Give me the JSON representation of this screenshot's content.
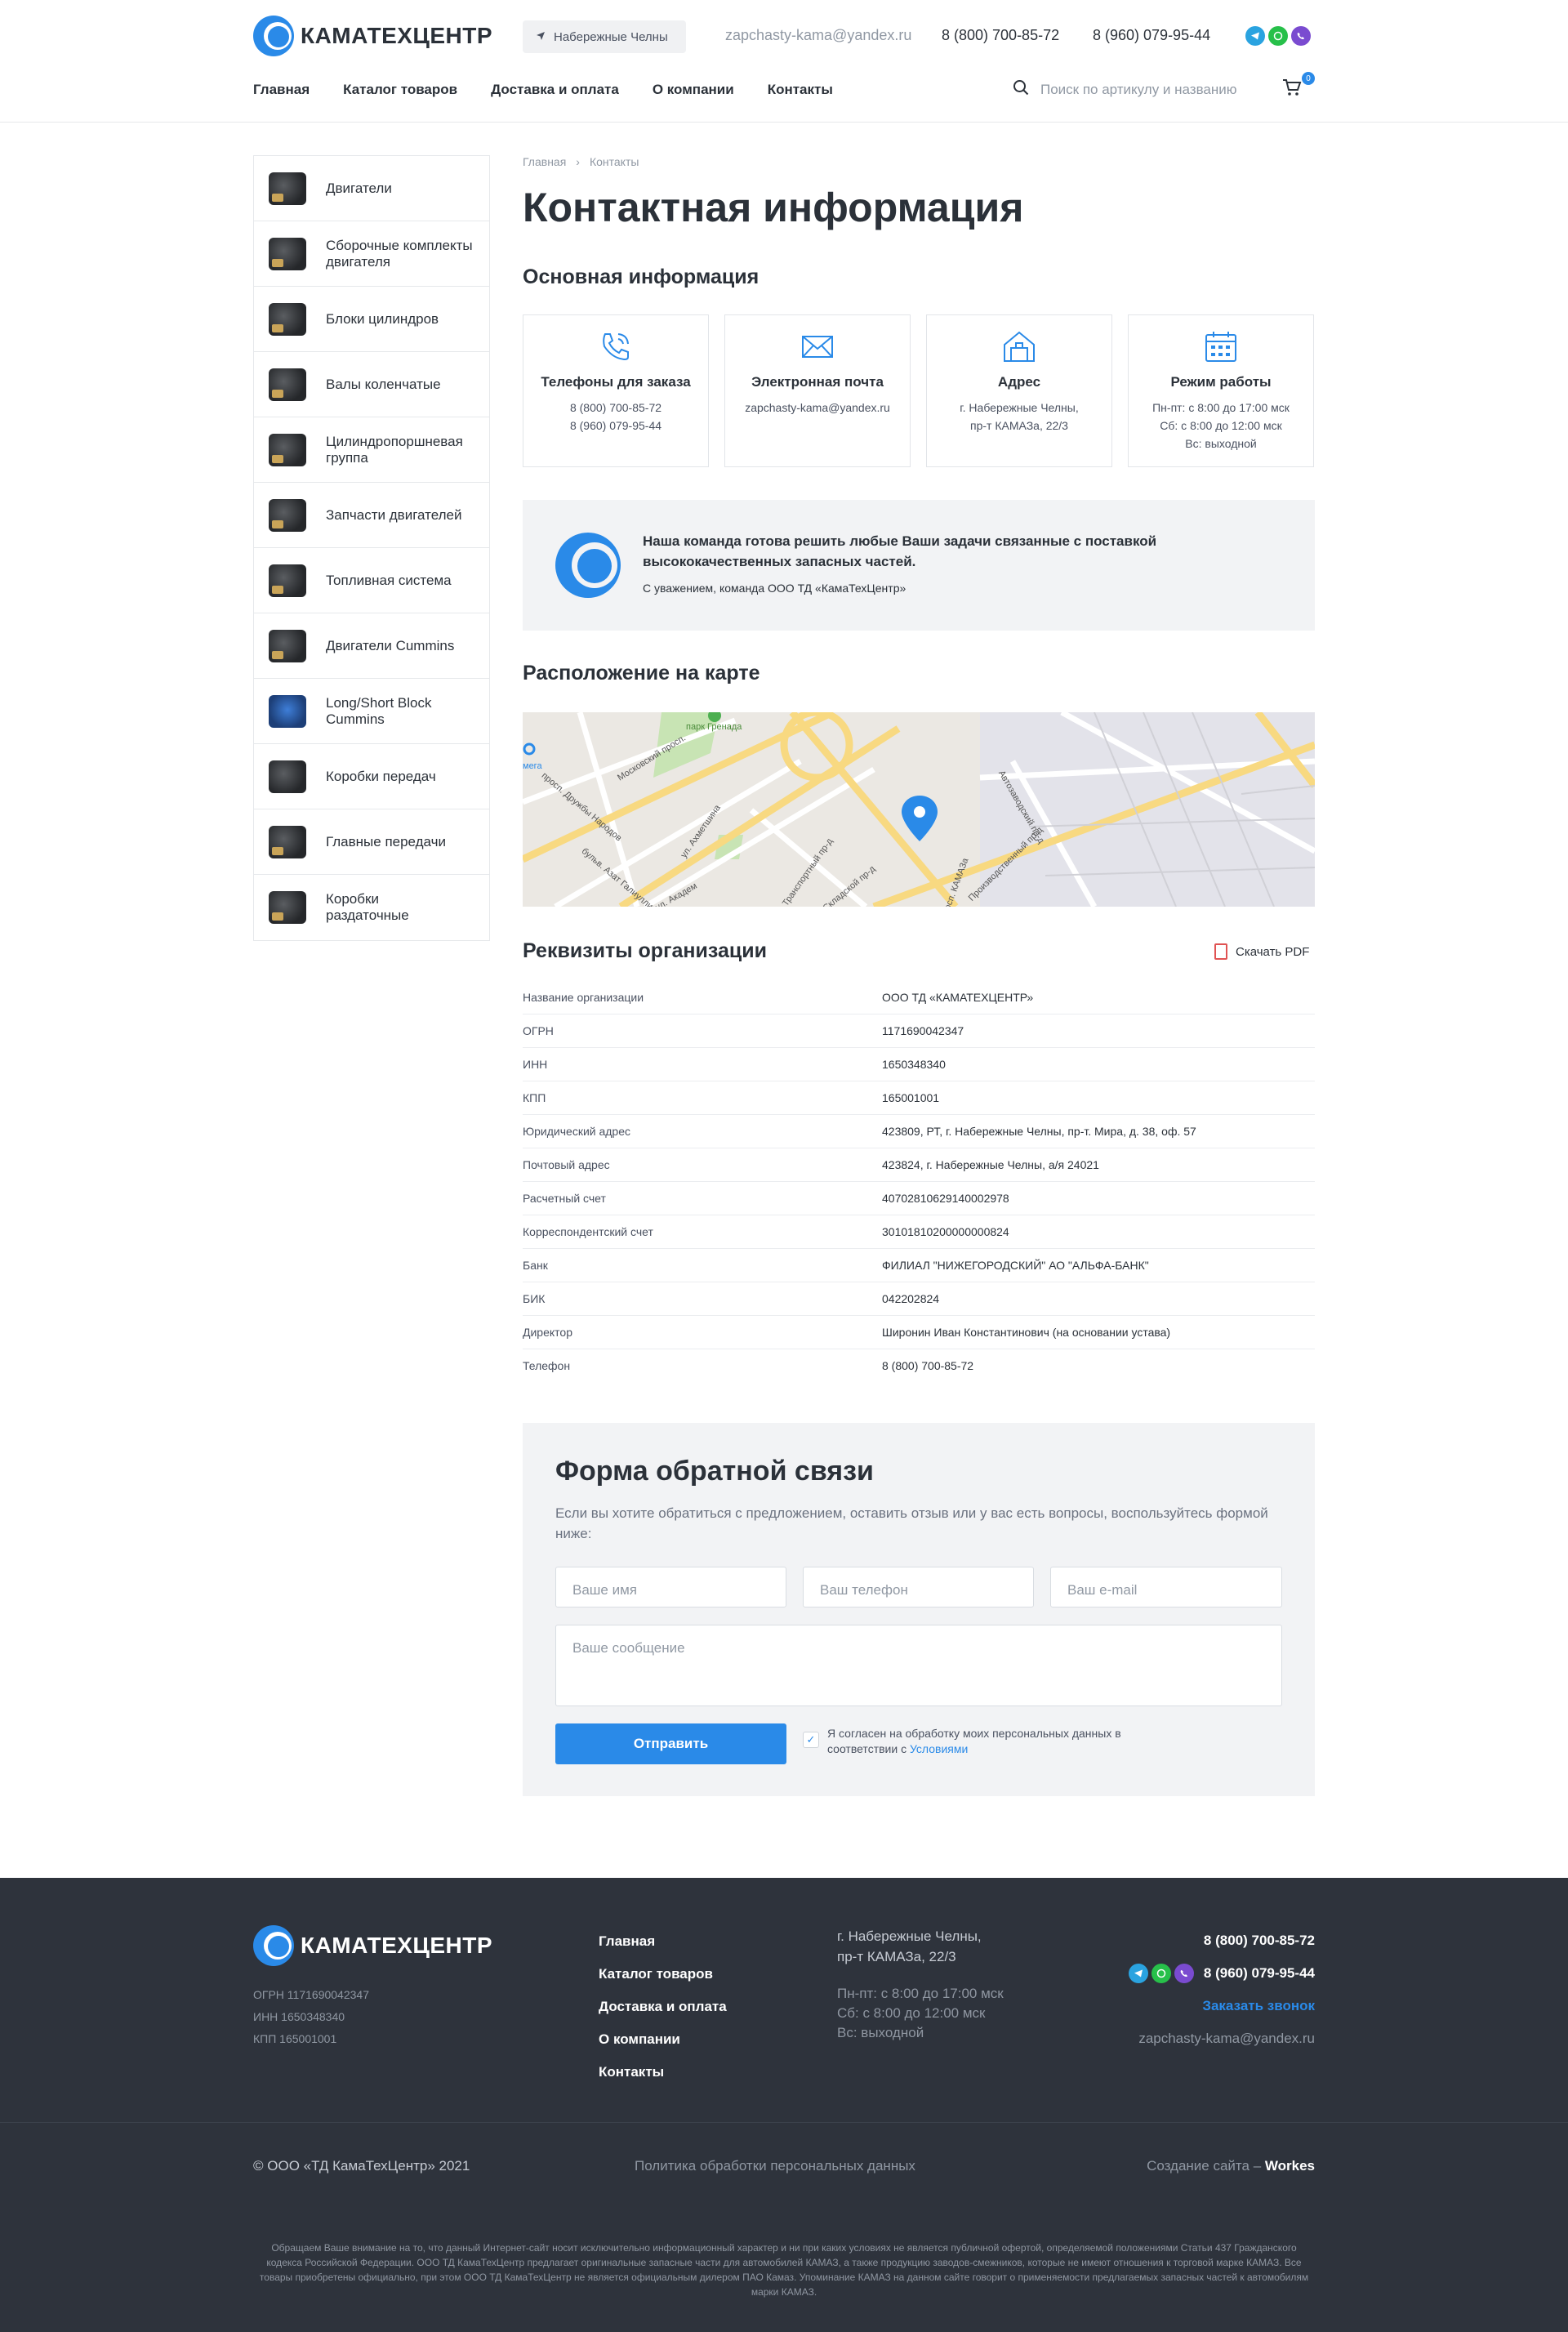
{
  "header": {
    "logo_text": "КАМАТЕХЦЕНТР",
    "city": "Набережные Челны",
    "email": "zapchasty-kama@yandex.ru",
    "phone1": "8 (800) 700-85-72",
    "phone2": "8 (960) 079-95-44",
    "social": [
      {
        "name": "telegram-icon",
        "color": "#2aa3e0"
      },
      {
        "name": "whatsapp-icon",
        "color": "#27c04a"
      },
      {
        "name": "viber-icon",
        "color": "#7a4bd0"
      }
    ],
    "nav": [
      "Главная",
      "Каталог товаров",
      "Доставка и оплата",
      "О компании",
      "Контакты"
    ],
    "search_placeholder": "Поиск по артикулу и названию",
    "cart_count": "0"
  },
  "sidebar": {
    "items": [
      "Двигатели",
      "Сборочные комплекты двигателя",
      "Блоки цилиндров",
      "Валы коленчатые",
      "Цилиндропоршневая группа",
      "Запчасти двигателей",
      "Топливная система",
      "Двигатели Cummins",
      "Long/Short Block Cummins",
      "Коробки передач",
      "Главные передачи",
      "Коробки раздаточные"
    ]
  },
  "main": {
    "breadcrumbs": [
      "Главная",
      "Контакты"
    ],
    "title": "Контактная информация",
    "basic_title": "Основная информация",
    "cards": [
      {
        "title": "Телефоны для заказа",
        "lines": [
          "8 (800) 700-85-72",
          "8 (960) 079-95-44"
        ]
      },
      {
        "title": "Электронная почта",
        "lines": [
          "zapchasty-kama@yandex.ru"
        ]
      },
      {
        "title": "Адрес",
        "lines": [
          "г. Набережные Челны,",
          "пр-т КАМАЗа, 22/3"
        ]
      },
      {
        "title": "Режим работы",
        "lines": [
          "Пн-пт: с 8:00 до 17:00 мск",
          "Сб: с 8:00 до 12:00 мск",
          "Вс: выходной"
        ]
      }
    ],
    "team_text": "Наша команда готова решить любые Ваши задачи связанные с поставкой высококачественных запасных частей.",
    "team_sign": "С уважением, команда ООО ТД «КамаТехЦентр»",
    "map_title": "Расположение на карте",
    "map_labels": [
      "парк Гренада",
      "Московский просп.",
      "просп. Дружбы Народов",
      "ул. Ахметшина",
      "бульв. Азат Галиуллин",
      "Транспортный пр-д",
      "Автозаводский пр-д",
      "Производственный пр-д",
      "Складской пр-д",
      "просп. КАМАЗа",
      "ул. Академ",
      "мега"
    ],
    "req_title": "Реквизиты организации",
    "pdf_label": "Скачать PDF",
    "requisites": [
      {
        "k": "Название организации",
        "v": "ООО ТД «КАМАТЕХЦЕНТР»"
      },
      {
        "k": "ОГРН",
        "v": "1171690042347"
      },
      {
        "k": "ИНН",
        "v": "1650348340"
      },
      {
        "k": "КПП",
        "v": "165001001"
      },
      {
        "k": "Юридический адрес",
        "v": "423809, РТ, г. Набережные Челны, пр-т. Мира, д. 38, оф. 57"
      },
      {
        "k": "Почтовый адрес",
        "v": "423824, г. Набережные Челны, а/я 24021"
      },
      {
        "k": "Расчетный счет",
        "v": "40702810629140002978"
      },
      {
        "k": "Корреспондентский счет",
        "v": "30101810200000000824"
      },
      {
        "k": "Банк",
        "v": "ФИЛИАЛ \"НИЖЕГОРОДСКИЙ\" АО \"АЛЬФА-БАНК\""
      },
      {
        "k": "БИК",
        "v": "042202824"
      },
      {
        "k": "Директор",
        "v": "Широнин Иван Константинович (на основании устава)"
      },
      {
        "k": "Телефон",
        "v": "8 (800) 700-85-72"
      }
    ],
    "form": {
      "title": "Форма обратной связи",
      "desc": "Если вы хотите обратиться с предложением, оставить отзыв или у вас есть вопросы, воспользуйтесь формой ниже:",
      "name_ph": "Ваше имя",
      "phone_ph": "Ваш телефон",
      "email_ph": "Ваш e-mail",
      "message_ph": "Ваше сообщение",
      "submit": "Отправить",
      "consent": "Я согласен на обработку моих персональных данных в соответствии с",
      "consent_link": "Условиями"
    }
  },
  "footer": {
    "logo_text": "КАМАТЕХЦЕНТР",
    "ogrn": "ОГРН 1171690042347",
    "inn": "ИНН 1650348340",
    "kpp": "КПП 165001001",
    "nav": [
      "Главная",
      "Каталог товаров",
      "Доставка и оплата",
      "О компании",
      "Контакты"
    ],
    "address1": "г. Набережные Челны,",
    "address2": "пр-т КАМАЗа, 22/3",
    "hours": [
      "Пн-пт: с 8:00 до 17:00 мск",
      "Сб: с 8:00 до 12:00 мск",
      "Вс: выходной"
    ],
    "phone1": "8 (800) 700-85-72",
    "phone2": "8 (960) 079-95-44",
    "callback": "Заказать звонок",
    "email": "zapchasty-kama@yandex.ru",
    "copyright": "© ООО «ТД КамаТехЦентр» 2021",
    "policy": "Политика обработки персональных данных",
    "made_by": "Создание сайта –",
    "made_by_name": "Workes",
    "disclaimer": "Обращаем Ваше внимание на то, что данный Интернет-сайт носит исключительно информационный характер и ни при каких условиях не является публичной офертой, определяемой положениями Статьи 437 Гражданского кодекса Российской Федерации. ООО ТД КамаТехЦентр предлагает оригинальные запасные части для автомобилей КАМАЗ, а также продукцию заводов-смежников, которые не имеют отношения к торговой марке КАМАЗ. Все товары приобретены официально, при этом ООО ТД КамаТехЦентр не является официальным дилером ПАО Камаз. Упоминание КАМАЗ на данном сайте говорит о применяемости предлагаемых запасных частей к автомобилям марки КАМАЗ."
  },
  "colors": {
    "accent": "#2a8ae8",
    "footer_bg": "#2e333c",
    "panel_bg": "#f2f3f5"
  }
}
